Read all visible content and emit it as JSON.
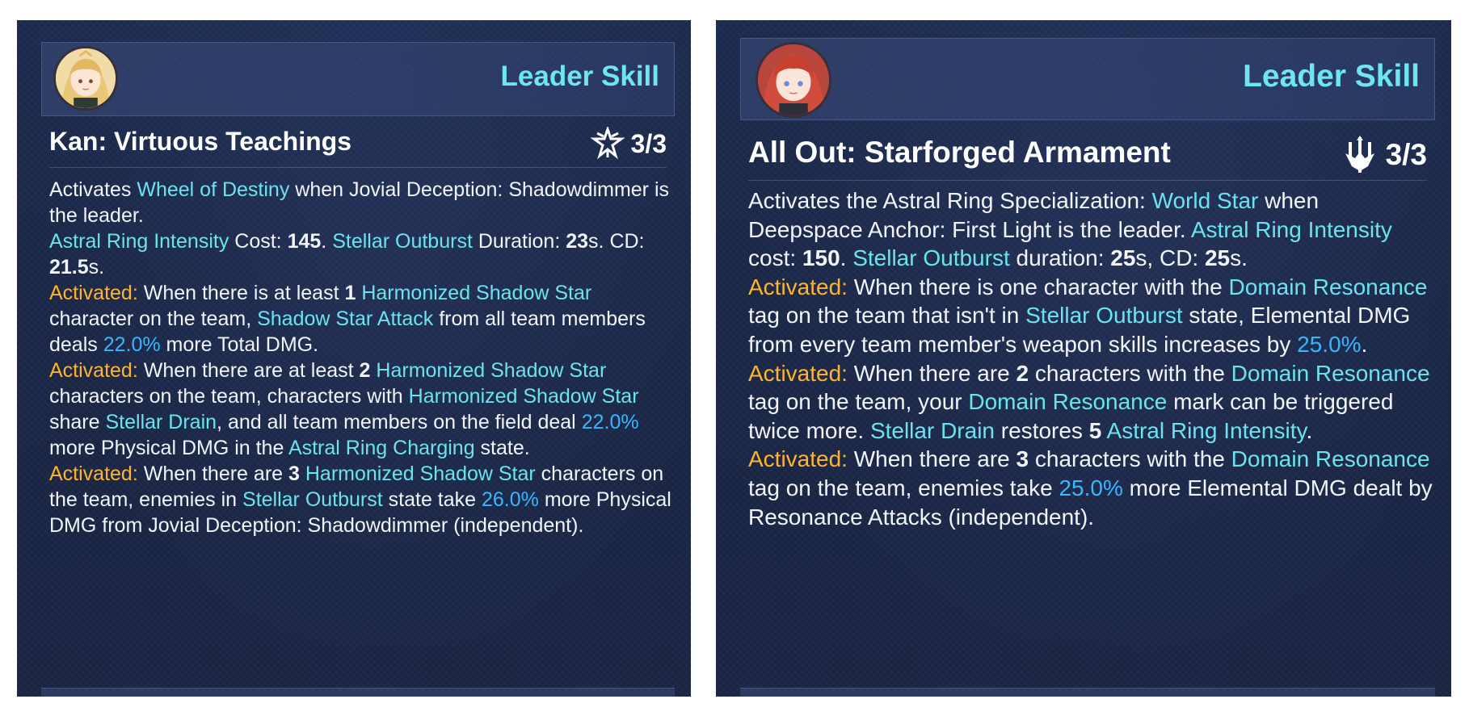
{
  "colors": {
    "keyword": "#6be3ee",
    "activated": "#ffb52b",
    "percent": "#35b8ff",
    "panel_bg": "#1b2747",
    "text": "#f2f4f8"
  },
  "left": {
    "header": {
      "label": "Leader Skill",
      "avatar_icon": "character-avatar-blonde"
    },
    "title": "Kan: Virtuous Teachings",
    "level": "3/3",
    "level_icon": "star-emblem-icon",
    "desc": [
      [
        {
          "t": "Activates ",
          "c": ""
        },
        {
          "t": "Wheel of Destiny",
          "c": "k"
        },
        {
          "t": " when Jovial Deception: Shadowdimmer is the leader.",
          "c": ""
        }
      ],
      [
        {
          "t": "Astral Ring Intensity",
          "c": "k"
        },
        {
          "t": " Cost: ",
          "c": ""
        },
        {
          "t": "145",
          "c": "n"
        },
        {
          "t": ". ",
          "c": ""
        },
        {
          "t": "Stellar Outburst",
          "c": "k"
        },
        {
          "t": " Duration: ",
          "c": ""
        },
        {
          "t": "23",
          "c": "n"
        },
        {
          "t": "s. CD: ",
          "c": ""
        },
        {
          "t": "21.5",
          "c": "n"
        },
        {
          "t": "s.",
          "c": ""
        }
      ],
      [
        {
          "t": "Activated:",
          "c": "a"
        },
        {
          "t": " When there is at least ",
          "c": ""
        },
        {
          "t": "1",
          "c": "n"
        },
        {
          "t": " ",
          "c": ""
        },
        {
          "t": "Harmonized Shadow Star",
          "c": "k"
        },
        {
          "t": " character on the team, ",
          "c": ""
        },
        {
          "t": "Shadow Star Attack",
          "c": "k"
        },
        {
          "t": " from all team members deals ",
          "c": ""
        },
        {
          "t": "22.0%",
          "c": "p"
        },
        {
          "t": " more Total DMG.",
          "c": ""
        }
      ],
      [
        {
          "t": "Activated:",
          "c": "a"
        },
        {
          "t": " When there are at least ",
          "c": ""
        },
        {
          "t": "2",
          "c": "n"
        },
        {
          "t": " ",
          "c": ""
        },
        {
          "t": "Harmonized Shadow Star",
          "c": "k"
        },
        {
          "t": " characters on the team, characters with ",
          "c": ""
        },
        {
          "t": "Harmonized Shadow Star",
          "c": "k"
        },
        {
          "t": " share ",
          "c": ""
        },
        {
          "t": "Stellar Drain",
          "c": "k"
        },
        {
          "t": ", and all team members on the field deal ",
          "c": ""
        },
        {
          "t": "22.0%",
          "c": "p"
        },
        {
          "t": " more Physical DMG in the ",
          "c": ""
        },
        {
          "t": "Astral Ring Charging",
          "c": "k"
        },
        {
          "t": " state.",
          "c": ""
        }
      ],
      [
        {
          "t": "Activated:",
          "c": "a"
        },
        {
          "t": " When there are ",
          "c": ""
        },
        {
          "t": "3",
          "c": "n"
        },
        {
          "t": " ",
          "c": ""
        },
        {
          "t": "Harmonized Shadow Star",
          "c": "k"
        },
        {
          "t": " characters on the team, enemies in ",
          "c": ""
        },
        {
          "t": "Stellar Outburst",
          "c": "k"
        },
        {
          "t": " state take ",
          "c": ""
        },
        {
          "t": "26.0%",
          "c": "p"
        },
        {
          "t": " more Physical DMG from Jovial Deception: Shadowdimmer (independent).",
          "c": ""
        }
      ]
    ]
  },
  "right": {
    "header": {
      "label": "Leader Skill",
      "avatar_icon": "character-avatar-redhead"
    },
    "title": "All Out: Starforged Armament",
    "level": "3/3",
    "level_icon": "trident-emblem-icon",
    "desc": [
      [
        {
          "t": "Activates the Astral Ring Specialization: ",
          "c": ""
        },
        {
          "t": "World Star",
          "c": "k"
        },
        {
          "t": " when Deepspace Anchor: First Light is the leader. ",
          "c": ""
        },
        {
          "t": "Astral Ring Intensity",
          "c": "k"
        },
        {
          "t": " cost: ",
          "c": ""
        },
        {
          "t": "150",
          "c": "n"
        },
        {
          "t": ". ",
          "c": ""
        },
        {
          "t": "Stellar Outburst",
          "c": "k"
        },
        {
          "t": " duration: ",
          "c": ""
        },
        {
          "t": "25",
          "c": "n"
        },
        {
          "t": "s, CD: ",
          "c": ""
        },
        {
          "t": "25",
          "c": "n"
        },
        {
          "t": "s.",
          "c": ""
        }
      ],
      [
        {
          "t": "Activated:",
          "c": "a"
        },
        {
          "t": " When there is one character with the ",
          "c": ""
        },
        {
          "t": "Domain Resonance",
          "c": "k"
        },
        {
          "t": " tag on the team that isn't in ",
          "c": ""
        },
        {
          "t": "Stellar Outburst",
          "c": "k"
        },
        {
          "t": " state, Elemental DMG from every team member's weapon skills increases by ",
          "c": ""
        },
        {
          "t": "25.0%",
          "c": "p"
        },
        {
          "t": ".",
          "c": ""
        }
      ],
      [
        {
          "t": "Activated:",
          "c": "a"
        },
        {
          "t": " When there are ",
          "c": ""
        },
        {
          "t": "2",
          "c": "n"
        },
        {
          "t": " characters with the ",
          "c": ""
        },
        {
          "t": "Domain Resonance",
          "c": "k"
        },
        {
          "t": " tag on the team, your ",
          "c": ""
        },
        {
          "t": "Domain Resonance",
          "c": "k"
        },
        {
          "t": " mark can be triggered twice more. ",
          "c": ""
        },
        {
          "t": "Stellar Drain",
          "c": "k"
        },
        {
          "t": " restores ",
          "c": ""
        },
        {
          "t": "5",
          "c": "n"
        },
        {
          "t": " ",
          "c": ""
        },
        {
          "t": "Astral Ring Intensity",
          "c": "k"
        },
        {
          "t": ".",
          "c": ""
        }
      ],
      [
        {
          "t": "Activated:",
          "c": "a"
        },
        {
          "t": " When there are ",
          "c": ""
        },
        {
          "t": "3",
          "c": "n"
        },
        {
          "t": " characters with the ",
          "c": ""
        },
        {
          "t": "Domain Resonance",
          "c": "k"
        },
        {
          "t": " tag on the team, enemies take ",
          "c": ""
        },
        {
          "t": "25.0%",
          "c": "p"
        },
        {
          "t": " more Elemental DMG dealt by Resonance Attacks (independent).",
          "c": ""
        }
      ]
    ]
  }
}
